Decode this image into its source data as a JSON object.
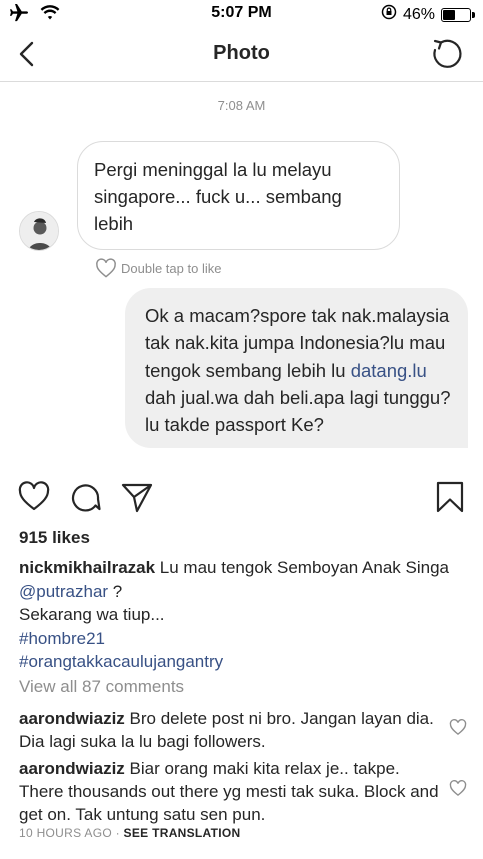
{
  "status_bar": {
    "time": "5:07 PM",
    "battery_percent": "46%",
    "battery_level": 0.46
  },
  "nav": {
    "title": "Photo"
  },
  "chat": {
    "timestamp": "7:08 AM",
    "incoming_message": "Pergi meninggal la lu melayu singapore... fuck u... sembang lebih",
    "like_hint": "Double tap to like",
    "outgoing_parts": {
      "before_link": "Ok a macam?spore tak nak.malaysia tak nak.kita jumpa Indonesia?lu mau tengok sembang lebih lu ",
      "link": "datang.lu",
      "after_link": " dah jual.wa dah beli.apa lagi tunggu? lu takde passport Ke?"
    }
  },
  "post": {
    "likes": "915 likes",
    "caption": {
      "username": "nickmikhailrazak",
      "text": " Lu mau tengok Semboyan Anak Singa ",
      "mention": "@putrazhar",
      "text_after": " ?",
      "line2": "Sekarang wa tiup...",
      "hashtag1": "#hombre21",
      "hashtag2": "#orangtakkacaulujangantry"
    },
    "view_all_comments": "View all 87 comments",
    "comments": [
      {
        "username": "aarondwiaziz",
        "text": " Bro delete post ni bro. Jangan layan dia. Dia lagi suka la lu bagi followers."
      },
      {
        "username": "aarondwiaziz",
        "text": " Biar orang maki kita relax je.. takpe. There thousands out there yg mesti tak suka. Block and get on. Tak untung satu sen pun."
      }
    ],
    "footer": {
      "time_ago": "10 HOURS AGO",
      "separator": " · ",
      "see_translation": "SEE TRANSLATION"
    }
  }
}
